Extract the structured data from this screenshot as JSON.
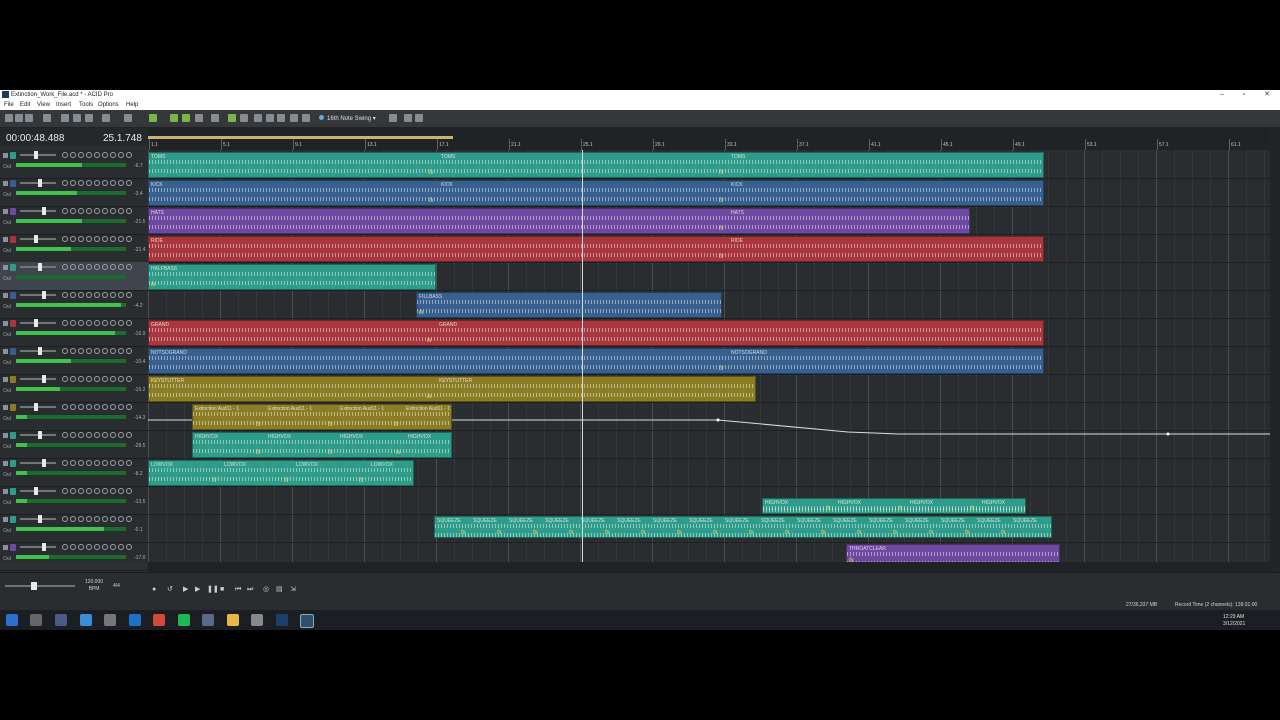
{
  "window": {
    "title": "Extinction_Work_File.acd * - ACID Pro"
  },
  "menu": [
    "File",
    "Edit",
    "View",
    "Insert",
    "Tools",
    "Options",
    "Help"
  ],
  "toolbar": {
    "swing_label": "16th Note Swing"
  },
  "time": {
    "position": "00:00:48.488",
    "measure": "25.1.748"
  },
  "ruler": {
    "labels": [
      "1.1",
      "5.1",
      "9.1",
      "13.1",
      "17.1",
      "21.1",
      "25.1",
      "29.1",
      "33.1",
      "37.1",
      "41.1",
      "45.1",
      "49.1",
      "53.1",
      "57.1",
      "61.1"
    ]
  },
  "tracks": [
    {
      "name": "TOMS",
      "color": "#2f9c8a",
      "db": "-6.7",
      "meter": 0.6
    },
    {
      "name": "KICK",
      "color": "#37608f",
      "db": "-3.4",
      "meter": 0.55
    },
    {
      "name": "HATS",
      "color": "#6d4aa0",
      "db": "-21.5",
      "meter": 0.6
    },
    {
      "name": "RIDE",
      "color": "#a8363e",
      "db": "-21.4",
      "meter": 0.5
    },
    {
      "name": "HALFBASS",
      "color": "#2f9c8a",
      "db": "",
      "meter": 0.0
    },
    {
      "name": "FILLBASS",
      "color": "#37608f",
      "db": "-4.2",
      "meter": 0.95
    },
    {
      "name": "GRAND",
      "color": "#a8363e",
      "db": "-16.9",
      "meter": 0.9
    },
    {
      "name": "NOTSOGRAND",
      "color": "#37608f",
      "db": "-10.4",
      "meter": 0.5
    },
    {
      "name": "KEYSTUTTER",
      "color": "#8a7d25",
      "db": "-15.2",
      "meter": 0.4
    },
    {
      "name": "Extinction Aud11 - 1",
      "color": "#8a7d25",
      "db": "-14.3",
      "meter": 0.1
    },
    {
      "name": "HIGHVOX",
      "color": "#2f9c8a",
      "db": "-28.5",
      "meter": 0.1
    },
    {
      "name": "LOWVOX",
      "color": "#2f9c8a",
      "db": "-8.2",
      "meter": 0.1
    },
    {
      "name": "HIGHVOX",
      "color": "#2f9c8a",
      "db": "-13.5",
      "meter": 0.1
    },
    {
      "name": "SQUEEZE",
      "color": "#2f9c8a",
      "db": "-0.1",
      "meter": 0.8
    },
    {
      "name": "THROATCLEAR",
      "color": "#6d4aa0",
      "db": "-17.0",
      "meter": 0.3
    }
  ],
  "transport": {
    "bpm_value": "120.000",
    "bpm_unit": "BPM",
    "time_sig": "4/4"
  },
  "status": {
    "memory": "27/36,337 MB",
    "record_time": "Record Time (2 channels): 138:31:00"
  },
  "taskbar": {
    "time": "12:29 AM",
    "date": "3/12/2021"
  }
}
